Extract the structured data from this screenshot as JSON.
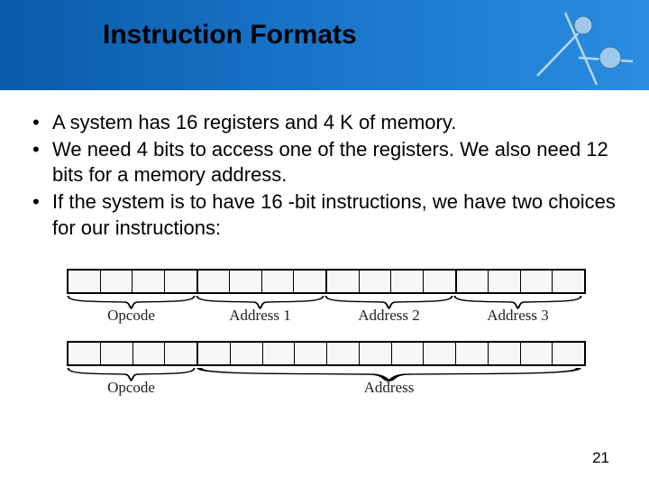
{
  "title": "Instruction Formats",
  "bullets": [
    "A system has 16 registers and 4 K of memory.",
    "We need 4 bits to access one of the registers. We also need 12 bits for a memory address.",
    "If the system is to have 16 -bit instructions, we have two choices for our instructions:"
  ],
  "diagram": {
    "row1": {
      "groups": [
        {
          "bits": 4,
          "label": "Opcode"
        },
        {
          "bits": 4,
          "label": "Address 1"
        },
        {
          "bits": 4,
          "label": "Address 2"
        },
        {
          "bits": 4,
          "label": "Address 3"
        }
      ]
    },
    "row2": {
      "groups": [
        {
          "bits": 4,
          "label": "Opcode"
        },
        {
          "bits": 12,
          "label": "Address"
        }
      ]
    }
  },
  "page_number": "21"
}
